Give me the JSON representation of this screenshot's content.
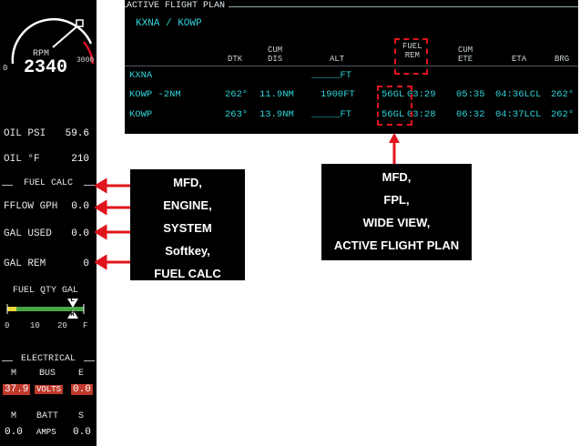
{
  "engine_panel": {
    "rpm_label": "RPM",
    "rpm_value": "2340",
    "gauge_min": "0",
    "gauge_max": "3000",
    "oil_psi_label": "OIL PSI",
    "oil_psi_value": "59.6",
    "oil_f_label": "OIL °F",
    "oil_f_value": "210",
    "fuel_calc_header": "FUEL CALC",
    "fflow_label": "FFLOW GPH",
    "fflow_value": "0.0",
    "gal_used_label": "GAL USED",
    "gal_used_value": "0.0",
    "gal_rem_label": "GAL REM",
    "gal_rem_value": "0",
    "fuel_qty_label": "FUEL QTY GAL",
    "fuel_scale": [
      "0",
      "10",
      "20",
      "F"
    ],
    "fuel_marker_left": "L",
    "fuel_marker_right": "R",
    "electrical_header": "ELECTRICAL",
    "bus_labels": [
      "M",
      "BUS",
      "E"
    ],
    "bus_m_value": "37.9",
    "bus_units": "VOLTS",
    "bus_e_value": "0.0",
    "batt_labels": [
      "M",
      "BATT",
      "S"
    ],
    "batt_m_value": "0.0",
    "batt_units": "AMPS",
    "batt_s_value": "0.0"
  },
  "flight_plan": {
    "title": "ACTIVE FLIGHT PLAN",
    "route": "KXNA / KOWP",
    "headers": {
      "dtk": "DTK",
      "cum_dis": [
        "CUM",
        "DIS"
      ],
      "alt": "ALT",
      "fuel_rem": [
        "FUEL",
        "REM"
      ],
      "cum_ete": [
        "CUM",
        "ETE"
      ],
      "eta": "ETA",
      "brg": "BRG"
    },
    "rows": [
      {
        "wpt": "KXNA",
        "dtk": "",
        "dis": "",
        "alt": "_____FT",
        "fuel": "",
        "ete_leg": "",
        "cum_ete": "",
        "eta": "",
        "brg": ""
      },
      {
        "wpt": "KOWP -2NM",
        "dtk": "262°",
        "dis": "11.9NM",
        "alt": "1900FT",
        "fuel": "56GL",
        "ete_leg": "03:29",
        "cum_ete": "05:35",
        "eta": "04:36LCL",
        "brg": "262°"
      },
      {
        "wpt": "KOWP",
        "dtk": "263°",
        "dis": "13.9NM",
        "alt": "_____FT",
        "fuel": "56GL",
        "ete_leg": "03:28",
        "cum_ete": "06:32",
        "eta": "04:37LCL",
        "brg": "262°"
      }
    ]
  },
  "callout_engine": {
    "lines": [
      "MFD,",
      "ENGINE,",
      "SYSTEM",
      "Softkey,",
      "FUEL CALC"
    ]
  },
  "callout_fpl": {
    "lines": [
      "MFD,",
      "FPL,",
      "WIDE VIEW,",
      "ACTIVE FLIGHT PLAN"
    ]
  },
  "colors": {
    "annotation_red": "#e0141c",
    "cyan_text": "#2ed3d8",
    "volts_box": "#c0392b"
  }
}
